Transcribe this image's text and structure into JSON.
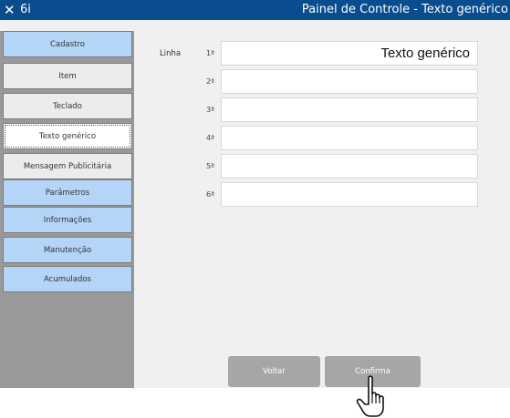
{
  "titlebar": {
    "close_glyph": "✕",
    "app_name": "6i",
    "title": "Painel de Controle - Texto genérico"
  },
  "sidebar": {
    "items": [
      {
        "label": "Cadastro",
        "style": "blue"
      },
      {
        "label": "Item",
        "style": "grey"
      },
      {
        "label": "Teclado",
        "style": "grey"
      },
      {
        "label": "Texto genérico",
        "style": "active"
      },
      {
        "label": "Mensagem Publicitária",
        "style": "grey"
      },
      {
        "label": "Parâmetros",
        "style": "blue"
      },
      {
        "label": "Informações",
        "style": "blue"
      },
      {
        "label": "Manutenção",
        "style": "blue"
      },
      {
        "label": "Acumulados",
        "style": "blue"
      }
    ]
  },
  "form": {
    "linha_label": "Linha",
    "lines": [
      {
        "ordinal": "1ª",
        "value": "Texto genérico"
      },
      {
        "ordinal": "2ª",
        "value": ""
      },
      {
        "ordinal": "3ª",
        "value": ""
      },
      {
        "ordinal": "4ª",
        "value": ""
      },
      {
        "ordinal": "5ª",
        "value": ""
      },
      {
        "ordinal": "6ª",
        "value": ""
      }
    ]
  },
  "actions": {
    "back_label": "Voltar",
    "confirm_label": "Confirma"
  },
  "colors": {
    "titlebar": "#0a4d8e",
    "nav_blue": "#b4d5f7",
    "nav_grey": "#ececec",
    "button_grey": "#a6a6a6"
  },
  "pointer": {
    "icon": "hand-pointer-icon"
  }
}
